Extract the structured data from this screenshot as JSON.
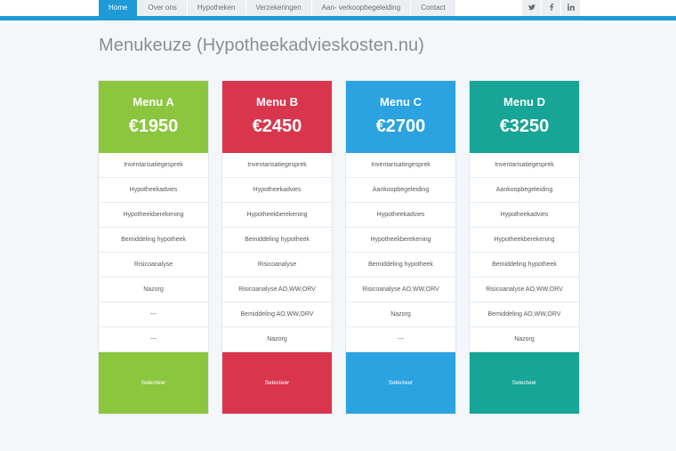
{
  "nav": {
    "items": [
      "Home",
      "Over ons",
      "Hypotheken",
      "Verzekeringen",
      "Aan- verkoopbegeleiding",
      "Contact"
    ],
    "active": "Home",
    "social": [
      "twitter-icon",
      "facebook-icon",
      "linkedin-icon"
    ]
  },
  "page": {
    "title": "Menukeuze (Hypotheekadvieskosten.nu)"
  },
  "plans": [
    {
      "name": "Menu A",
      "price": "€1950",
      "color": "#8cc63f",
      "features": [
        "Inventarisatiegesprek",
        "Hypotheekadvies",
        "Hypotheekberekening",
        "Bemiddeling hypotheek",
        "Risicoanalyse",
        "Nazorg",
        "---",
        "---"
      ],
      "button": "Selecteer"
    },
    {
      "name": "Menu B",
      "price": "€2450",
      "color": "#d9364e",
      "features": [
        "Inventarisatiegesprek",
        "Hypotheekadvies",
        "Hypotheekberekening",
        "Bemiddeling hypotheek",
        "Risicoanalyse",
        "Risicoanalyse AO,WW,ORV",
        "Bemiddeling AO,WW,ORV",
        "Nazorg"
      ],
      "button": "Selecteer"
    },
    {
      "name": "Menu C",
      "price": "€2700",
      "color": "#2aa3e0",
      "features": [
        "Inventarisatiegesprek",
        "Aankoopbegeleiding",
        "Hypotheekadvies",
        "Hypotheekberekening",
        "Bemiddeling hypotheek",
        "Risicoanalyse AO,WW,ORV",
        "Nazorg",
        "---"
      ],
      "button": "Selecteer"
    },
    {
      "name": "Menu D",
      "price": "€3250",
      "color": "#16a596",
      "features": [
        "Inventarisatiegesprek",
        "Aankoopbegeleiding",
        "Hypotheekadvies",
        "Hypotheekberekening",
        "Bemiddeling hypotheek",
        "Risicoanalyse AO,WW,ORV",
        "Bemiddeling AO,WW,ORV",
        "Nazorg"
      ],
      "button": "Selecteer"
    }
  ]
}
